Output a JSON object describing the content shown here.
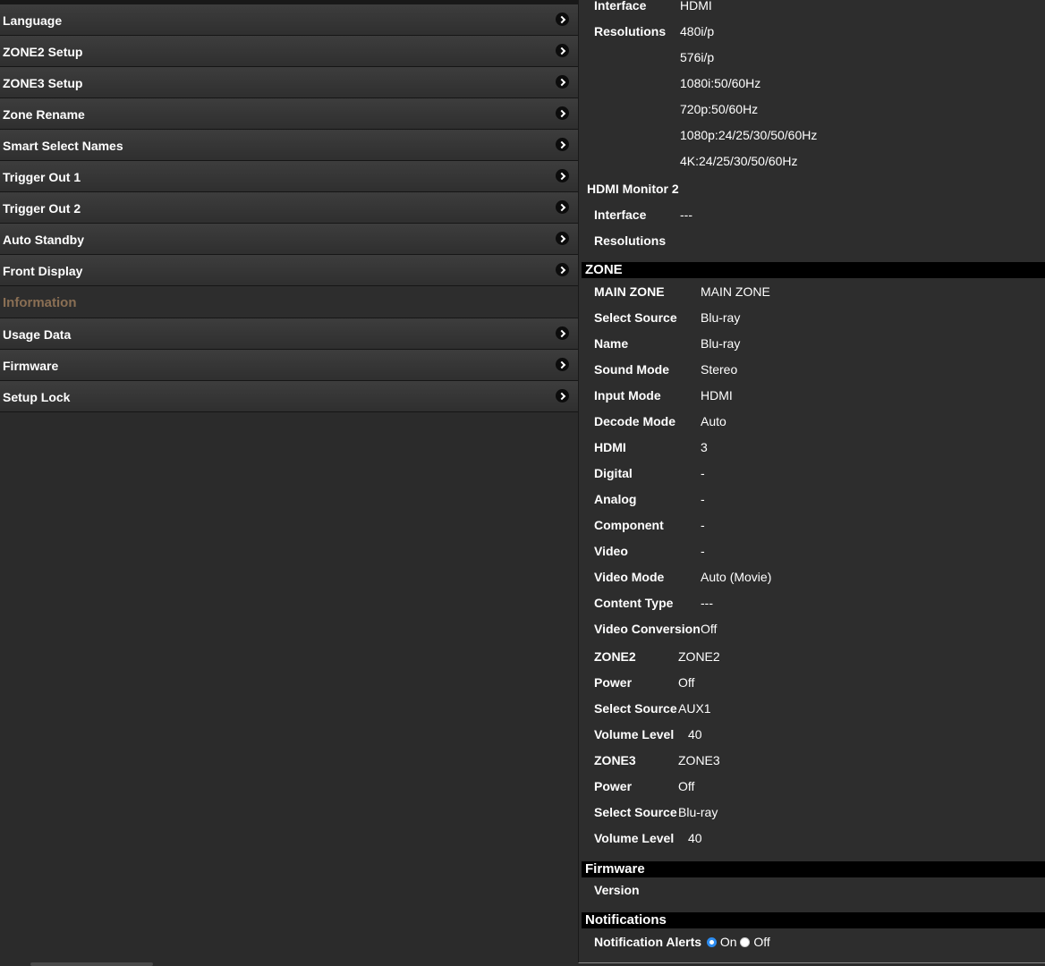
{
  "menu": {
    "items_top": [
      {
        "label": "Language"
      },
      {
        "label": "ZONE2 Setup"
      },
      {
        "label": "ZONE3 Setup"
      },
      {
        "label": "Zone Rename"
      },
      {
        "label": "Smart Select Names"
      },
      {
        "label": "Trigger Out 1"
      },
      {
        "label": "Trigger Out 2"
      },
      {
        "label": "Auto Standby"
      },
      {
        "label": "Front Display"
      }
    ],
    "header": "Information",
    "items_bottom": [
      {
        "label": "Usage Data"
      },
      {
        "label": "Firmware"
      },
      {
        "label": "Setup Lock"
      }
    ]
  },
  "hdmi1": {
    "interface_label": "Interface",
    "interface_value": "HDMI",
    "resolutions_label": "Resolutions",
    "resolutions": [
      "480i/p",
      "576i/p",
      "1080i:50/60Hz",
      "720p:50/60Hz",
      "1080p:24/25/30/50/60Hz",
      "4K:24/25/30/50/60Hz"
    ]
  },
  "hdmi2": {
    "title": "HDMI Monitor 2",
    "interface_label": "Interface",
    "interface_value": "---",
    "resolutions_label": "Resolutions"
  },
  "zone": {
    "title": "ZONE",
    "main": [
      {
        "k": "MAIN ZONE",
        "v": "MAIN ZONE"
      },
      {
        "k": "Select Source",
        "v": "Blu-ray"
      },
      {
        "k": "Name",
        "v": "Blu-ray"
      },
      {
        "k": "Sound Mode",
        "v": "Stereo"
      },
      {
        "k": "Input Mode",
        "v": "HDMI"
      },
      {
        "k": "Decode Mode",
        "v": "Auto"
      },
      {
        "k": "HDMI",
        "v": "3"
      },
      {
        "k": "Digital",
        "v": "-"
      },
      {
        "k": "Analog",
        "v": "-"
      },
      {
        "k": "Component",
        "v": "-"
      },
      {
        "k": "Video",
        "v": "-"
      },
      {
        "k": "Video Mode",
        "v": "Auto (Movie)"
      },
      {
        "k": "Content Type",
        "v": "---"
      },
      {
        "k": "Video Conversion",
        "v": "Off"
      }
    ],
    "zone2": [
      {
        "k": "ZONE2",
        "v": "ZONE2"
      },
      {
        "k": "Power",
        "v": "Off"
      },
      {
        "k": "Select Source",
        "v": "AUX1"
      },
      {
        "k": "Volume Level",
        "v": "40"
      }
    ],
    "zone3": [
      {
        "k": "ZONE3",
        "v": "ZONE3"
      },
      {
        "k": "Power",
        "v": "Off"
      },
      {
        "k": "Select Source",
        "v": "Blu-ray"
      },
      {
        "k": "Volume Level",
        "v": "40"
      }
    ]
  },
  "firmware": {
    "title": "Firmware",
    "version_label": "Version"
  },
  "notifications": {
    "title": "Notifications",
    "alerts_label": "Notification Alerts",
    "on_label": "On",
    "off_label": "Off"
  }
}
